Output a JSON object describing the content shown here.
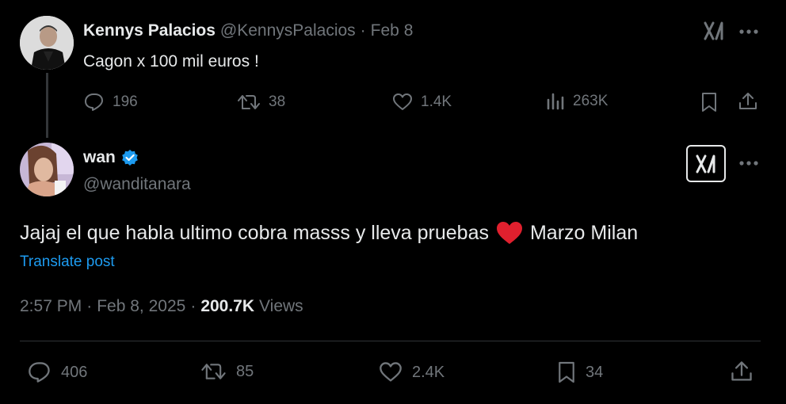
{
  "parent_tweet": {
    "display_name": "Kennys Palacios",
    "handle": "@KennysPalacios",
    "separator": "·",
    "date": "Feb 8",
    "text": "Cagon x 100 mil euros !",
    "replies": "196",
    "reposts": "38",
    "likes": "1.4K",
    "views": "263K"
  },
  "main_tweet": {
    "display_name": "wan",
    "verified": true,
    "handle": "@wanditanara",
    "text_before_emoji": "Jajaj el que habla ultimo cobra masss y lleva pruebas",
    "emoji": "heart",
    "text_after_emoji": "Marzo Milan",
    "translate_label": "Translate post",
    "time": "2:57 PM",
    "separator": "·",
    "date": "Feb 8, 2025",
    "view_count": "200.7K",
    "views_label": "Views",
    "replies": "406",
    "reposts": "85",
    "likes": "2.4K",
    "bookmarks": "34"
  },
  "colors": {
    "background": "#000000",
    "text": "#e7e9ea",
    "muted": "#71767b",
    "link": "#1d9bf0",
    "heart": "#f91880"
  },
  "icons": [
    "grok-icon",
    "more-icon",
    "reply-icon",
    "repost-icon",
    "like-icon",
    "views-icon",
    "bookmark-icon",
    "share-icon",
    "verified-badge-icon"
  ]
}
